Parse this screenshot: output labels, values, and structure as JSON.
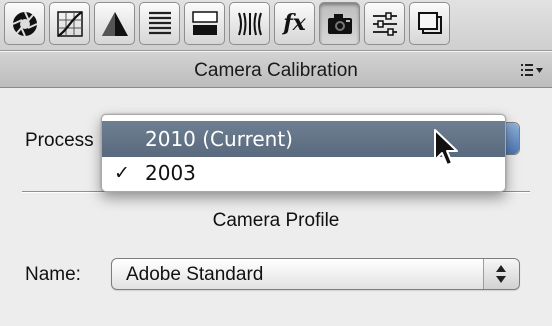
{
  "toolbar": {
    "tabs": [
      {
        "icon": "aperture-icon",
        "active": false
      },
      {
        "icon": "tone-curve-icon",
        "active": false
      },
      {
        "icon": "split-toning-icon",
        "active": false
      },
      {
        "icon": "hsl-icon",
        "active": false
      },
      {
        "icon": "grayscale-icon",
        "active": false
      },
      {
        "icon": "lens-corrections-icon",
        "active": false
      },
      {
        "icon": "effects-icon",
        "label": "fx",
        "active": false
      },
      {
        "icon": "camera-icon",
        "active": true
      },
      {
        "icon": "presets-sliders-icon",
        "active": false
      },
      {
        "icon": "snapshots-icon",
        "active": false
      }
    ]
  },
  "panel": {
    "title": "Camera Calibration",
    "menu_icon": "panel-menu-icon"
  },
  "process": {
    "label": "Process",
    "menu": {
      "items": [
        {
          "label": "2010 (Current)",
          "checked": false,
          "highlighted": true
        },
        {
          "label": "2003",
          "checked": true,
          "highlighted": false
        }
      ],
      "check_glyph": "✓"
    }
  },
  "camera_profile": {
    "section_title": "Camera Profile",
    "name_label": "Name:",
    "name_value": "Adobe Standard"
  },
  "colors": {
    "highlight": "#5f6f83",
    "select_stepper_blue": "#4e78b4"
  }
}
